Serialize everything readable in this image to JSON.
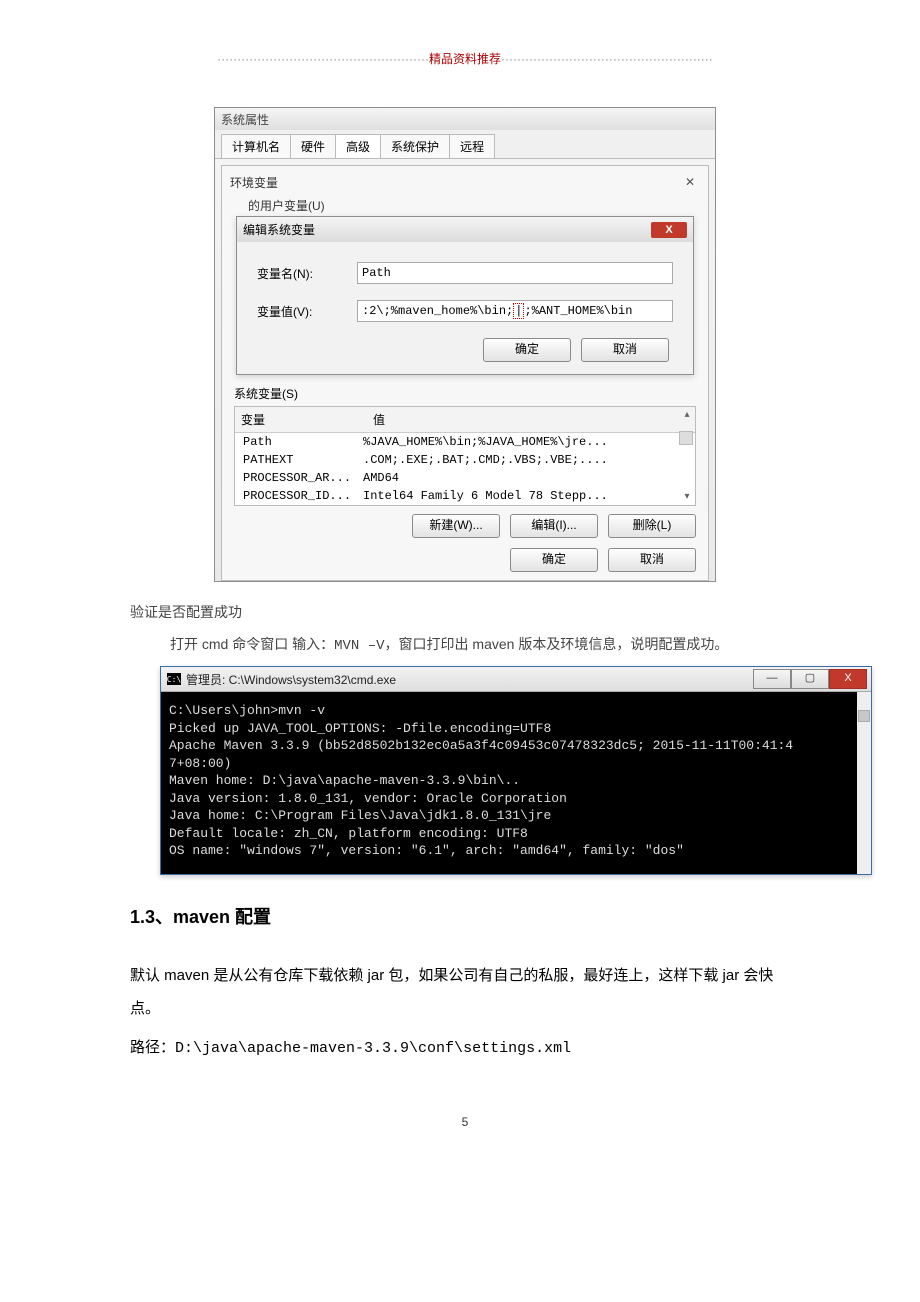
{
  "header": {
    "left_dots": "·····················································",
    "mid": "精品资料推荐",
    "right_dots": "·····················································"
  },
  "dlg": {
    "sysprops_title": "系统属性",
    "tabs": [
      "计算机名",
      "硬件",
      "高级",
      "系统保护",
      "远程"
    ],
    "active_tab": "高级",
    "envvars_title": "环境变量",
    "close_glyph": "✕",
    "user_vars_truncated": "的用户变量(U)",
    "edit_dialog_title": "编辑系统变量",
    "close_red": "X",
    "name_label": "变量名(N):",
    "name_value": "Path",
    "value_label": "变量值(V):",
    "value_prefix": ":2\\;%maven_home%\\bin;",
    "value_suffix": ";%ANT_HOME%\\bin",
    "ok": "确定",
    "cancel": "取消",
    "sys_vars_label": "系统变量(S)",
    "col_var": "变量",
    "col_val": "值",
    "rows": [
      {
        "var": "Path",
        "val": "%JAVA_HOME%\\bin;%JAVA_HOME%\\jre..."
      },
      {
        "var": "PATHEXT",
        "val": ".COM;.EXE;.BAT;.CMD;.VBS;.VBE;...."
      },
      {
        "var": "PROCESSOR_AR...",
        "val": "AMD64"
      },
      {
        "var": "PROCESSOR_ID...",
        "val": "Intel64 Family 6 Model 78 Stepp..."
      }
    ],
    "btn_new": "新建(W)...",
    "btn_edit": "编辑(I)...",
    "btn_del": "删除(L)"
  },
  "text": {
    "verify_title": "验证是否配置成功",
    "verify_instr_prefix": "打开 cmd 命令窗口 输入：",
    "verify_cmd": "MVN –V",
    "verify_instr_suffix": "，窗口打印出 maven 版本及环境信息，说明配置成功。"
  },
  "cmd": {
    "title": "管理员: C:\\Windows\\system32\\cmd.exe",
    "min": "—",
    "max": "▢",
    "close": "X",
    "lines": [
      "C:\\Users\\john>mvn -v",
      "Picked up JAVA_TOOL_OPTIONS: -Dfile.encoding=UTF8",
      "Apache Maven 3.3.9 (bb52d8502b132ec0a5a3f4c09453c07478323dc5; 2015-11-11T00:41:4",
      "7+08:00)",
      "Maven home: D:\\java\\apache-maven-3.3.9\\bin\\..",
      "Java version: 1.8.0_131, vendor: Oracle Corporation",
      "Java home: C:\\Program Files\\Java\\jdk1.8.0_131\\jre",
      "Default locale: zh_CN, platform encoding: UTF8",
      "OS name: \"windows 7\", version: \"6.1\", arch: \"amd64\", family: \"dos\""
    ]
  },
  "section": {
    "heading": "1.3、maven 配置",
    "p1": "默认 maven 是从公有仓库下载依赖 jar 包，如果公司有自己的私服，最好连上，这样下载 jar 会快点。",
    "p2_prefix": "路径：",
    "p2_path": "D:\\java\\apache-maven-3.3.9\\conf\\settings.xml"
  },
  "pagenum": "5"
}
